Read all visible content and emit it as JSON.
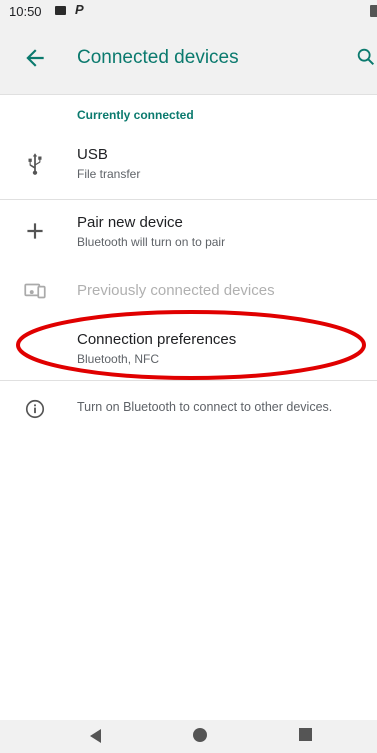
{
  "status_bar": {
    "time": "10:50"
  },
  "header": {
    "title": "Connected devices"
  },
  "section": {
    "currently_connected": "Currently connected"
  },
  "usb": {
    "title": "USB",
    "subtitle": "File transfer"
  },
  "pair": {
    "title": "Pair new device",
    "subtitle": "Bluetooth will turn on to pair"
  },
  "previous": {
    "title": "Previously connected devices"
  },
  "prefs": {
    "title": "Connection preferences",
    "subtitle": "Bluetooth, NFC"
  },
  "info": {
    "text": "Turn on Bluetooth to connect to other devices."
  },
  "colors": {
    "accent": "#0b7a6e",
    "annotation": "#e00000"
  },
  "icons": {
    "back": "arrow-back-icon",
    "search": "search-icon",
    "usb": "usb-icon",
    "add": "plus-icon",
    "devices": "devices-icon",
    "info": "info-icon"
  }
}
